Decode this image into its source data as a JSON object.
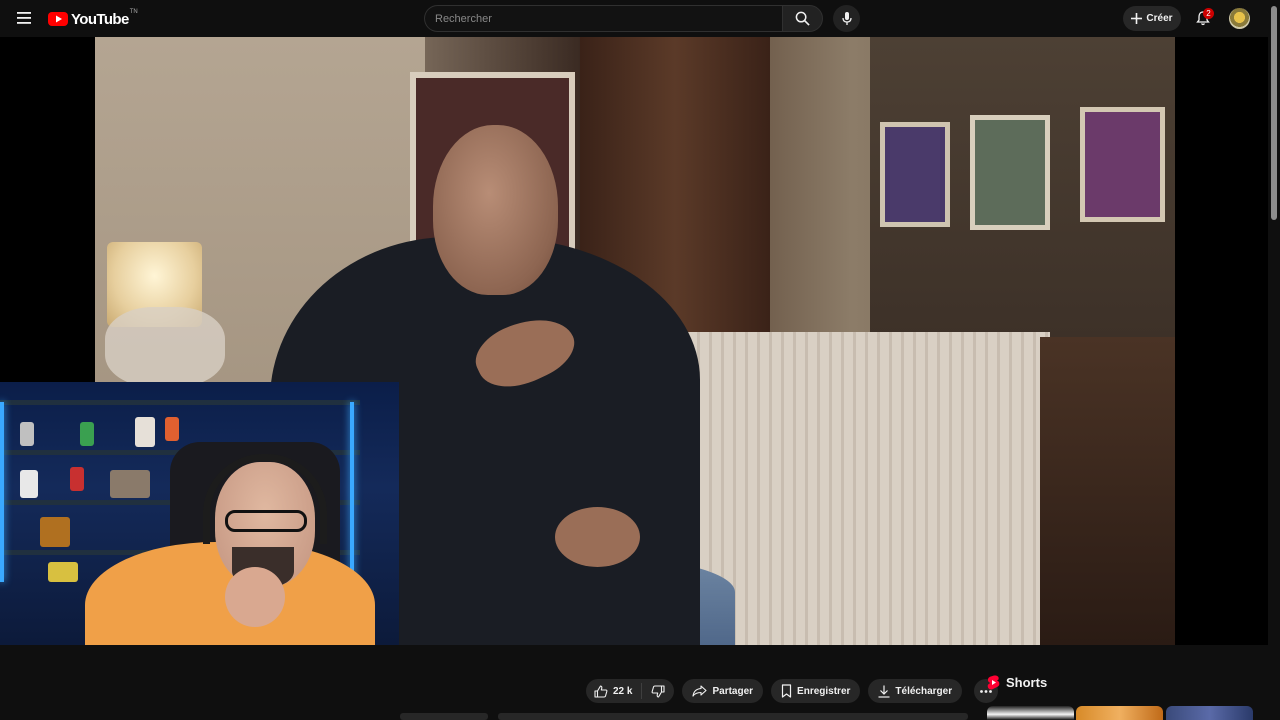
{
  "header": {
    "logo_text": "YouTube",
    "logo_region": "TN",
    "search_placeholder": "Rechercher",
    "create_label": "Créer",
    "notification_count": "2",
    "colors": {
      "background": "#0f0f0f",
      "brand_red": "#ff0000",
      "badge_red": "#cc0000"
    }
  },
  "actions": {
    "like_count": "22 k",
    "share_label": "Partager",
    "save_label": "Enregistrer",
    "download_label": "Télécharger"
  },
  "sidebar": {
    "shorts_title": "Shorts"
  },
  "icons": {
    "menu": "hamburger-menu-icon",
    "search": "search-icon",
    "mic": "microphone-icon",
    "create": "plus-icon",
    "notifications": "bell-icon",
    "like": "thumbs-up-icon",
    "dislike": "thumbs-down-icon",
    "share": "share-arrow-icon",
    "save": "bookmark-icon",
    "download": "download-icon",
    "more": "more-horizontal-icon",
    "shorts": "shorts-icon"
  }
}
